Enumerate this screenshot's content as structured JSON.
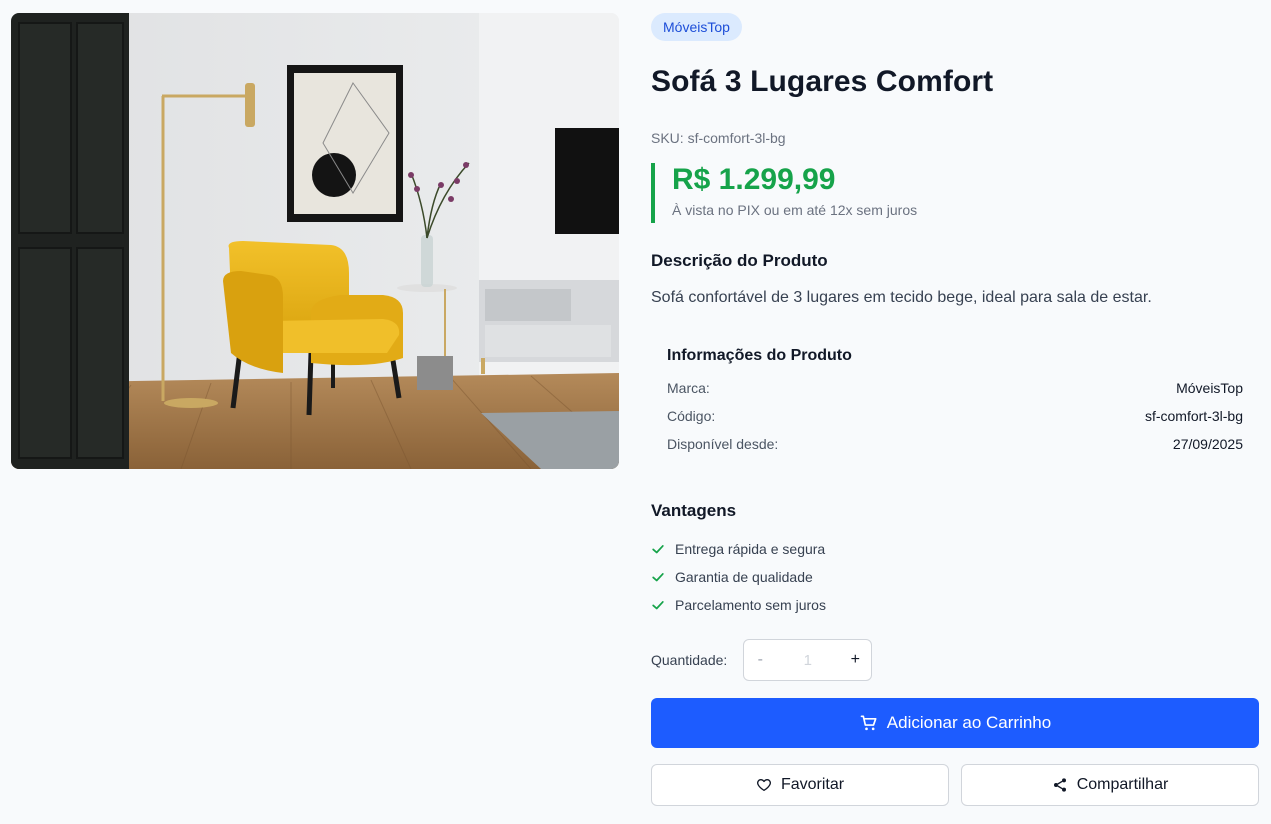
{
  "product": {
    "brand": "MóveisTop",
    "title": "Sofá 3 Lugares Comfort",
    "sku_label": "SKU: sf-comfort-3l-bg",
    "price": "R$ 1.299,99",
    "price_note": "À vista no PIX ou em até 12x sem juros",
    "image_alt": "Poltrona amarela em sala de estar"
  },
  "description": {
    "title": "Descrição do Produto",
    "text": "Sofá confortável de 3 lugares em tecido bege, ideal para sala de estar."
  },
  "info": {
    "title": "Informações do Produto",
    "rows": [
      {
        "label": "Marca:",
        "value": "MóveisTop"
      },
      {
        "label": "Código:",
        "value": "sf-comfort-3l-bg"
      },
      {
        "label": "Disponível desde:",
        "value": "27/09/2025"
      }
    ]
  },
  "advantages": {
    "title": "Vantagens",
    "items": [
      "Entrega rápida e segura",
      "Garantia de qualidade",
      "Parcelamento sem juros"
    ],
    "icon": "check-icon"
  },
  "quantity": {
    "label": "Quantidade:",
    "minus": "-",
    "value": "1",
    "plus": "+"
  },
  "actions": {
    "add_to_cart": "Adicionar ao Carrinho",
    "favorite": "Favoritar",
    "share": "Compartilhar"
  },
  "colors": {
    "accent_blue": "#1d5cff",
    "price_green": "#16a34a",
    "badge_bg": "#dbeafe",
    "badge_text": "#1d4ed8"
  }
}
